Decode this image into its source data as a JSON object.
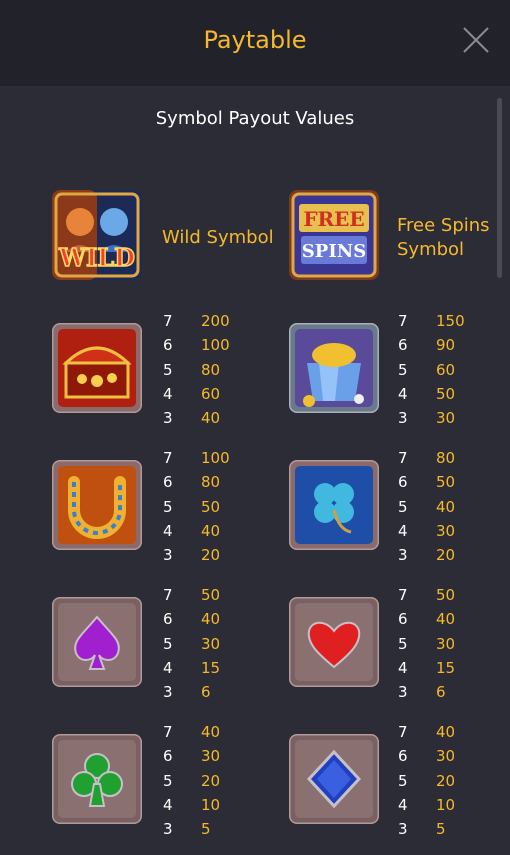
{
  "header": {
    "title": "Paytable"
  },
  "subtitle": "Symbol Payout Values",
  "special": {
    "wild": {
      "label": "Wild Symbol",
      "icon_text": "WILD"
    },
    "free_spins": {
      "label_line1": "Free Spins",
      "label_line2": "Symbol",
      "icon_text_1": "FREE",
      "icon_text_2": "SPINS"
    }
  },
  "symbols": [
    {
      "icon": "treasure-chest-icon",
      "pays": [
        {
          "count": "7",
          "amount": "200"
        },
        {
          "count": "6",
          "amount": "100"
        },
        {
          "count": "5",
          "amount": "80"
        },
        {
          "count": "4",
          "amount": "60"
        },
        {
          "count": "3",
          "amount": "40"
        }
      ]
    },
    {
      "icon": "gold-pot-icon",
      "pays": [
        {
          "count": "7",
          "amount": "150"
        },
        {
          "count": "6",
          "amount": "90"
        },
        {
          "count": "5",
          "amount": "60"
        },
        {
          "count": "4",
          "amount": "50"
        },
        {
          "count": "3",
          "amount": "30"
        }
      ]
    },
    {
      "icon": "horseshoe-icon",
      "pays": [
        {
          "count": "7",
          "amount": "100"
        },
        {
          "count": "6",
          "amount": "80"
        },
        {
          "count": "5",
          "amount": "50"
        },
        {
          "count": "4",
          "amount": "40"
        },
        {
          "count": "3",
          "amount": "20"
        }
      ]
    },
    {
      "icon": "four-leaf-clover-icon",
      "pays": [
        {
          "count": "7",
          "amount": "80"
        },
        {
          "count": "6",
          "amount": "50"
        },
        {
          "count": "5",
          "amount": "40"
        },
        {
          "count": "4",
          "amount": "30"
        },
        {
          "count": "3",
          "amount": "20"
        }
      ]
    },
    {
      "icon": "spade-icon",
      "pays": [
        {
          "count": "7",
          "amount": "50"
        },
        {
          "count": "6",
          "amount": "40"
        },
        {
          "count": "5",
          "amount": "30"
        },
        {
          "count": "4",
          "amount": "15"
        },
        {
          "count": "3",
          "amount": "6"
        }
      ]
    },
    {
      "icon": "heart-icon",
      "pays": [
        {
          "count": "7",
          "amount": "50"
        },
        {
          "count": "6",
          "amount": "40"
        },
        {
          "count": "5",
          "amount": "30"
        },
        {
          "count": "4",
          "amount": "15"
        },
        {
          "count": "3",
          "amount": "6"
        }
      ]
    },
    {
      "icon": "club-icon",
      "pays": [
        {
          "count": "7",
          "amount": "40"
        },
        {
          "count": "6",
          "amount": "30"
        },
        {
          "count": "5",
          "amount": "20"
        },
        {
          "count": "4",
          "amount": "10"
        },
        {
          "count": "3",
          "amount": "5"
        }
      ]
    },
    {
      "icon": "diamond-icon",
      "pays": [
        {
          "count": "7",
          "amount": "40"
        },
        {
          "count": "6",
          "amount": "30"
        },
        {
          "count": "5",
          "amount": "20"
        },
        {
          "count": "4",
          "amount": "10"
        },
        {
          "count": "3",
          "amount": "5"
        }
      ]
    }
  ],
  "colors": {
    "accent": "#f5b92b",
    "background": "#2c2c36",
    "header": "#22222a"
  }
}
